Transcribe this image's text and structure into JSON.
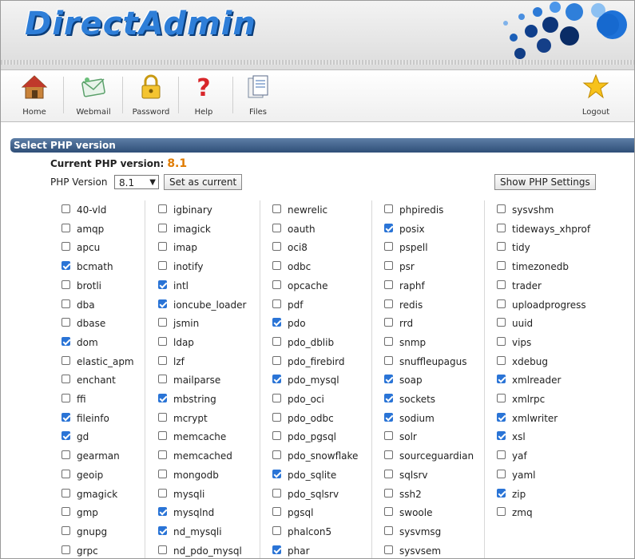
{
  "header": {
    "logo_text": "DirectAdmin"
  },
  "toolbar": {
    "items": [
      {
        "label": "Home",
        "icon": "home-icon"
      },
      {
        "label": "Webmail",
        "icon": "mail-icon"
      },
      {
        "label": "Password",
        "icon": "lock-icon"
      },
      {
        "label": "Help",
        "icon": "question-icon"
      },
      {
        "label": "Files",
        "icon": "files-icon"
      },
      {
        "label": "Logout",
        "icon": "star-icon"
      }
    ]
  },
  "section": {
    "title": "Select PHP version"
  },
  "current": {
    "label": "Current PHP version:",
    "value": "8.1"
  },
  "version_row": {
    "label": "PHP Version",
    "selected": "8.1",
    "set_button": "Set as current",
    "show_button": "Show PHP Settings"
  },
  "colors": {
    "accent": "#2a74d6",
    "section_bar": "#3d5f88",
    "version_value": "#e07b00"
  },
  "extensions": [
    [
      {
        "name": "40-vld",
        "checked": false
      },
      {
        "name": "amqp",
        "checked": false
      },
      {
        "name": "apcu",
        "checked": false
      },
      {
        "name": "bcmath",
        "checked": true
      },
      {
        "name": "brotli",
        "checked": false
      },
      {
        "name": "dba",
        "checked": false
      },
      {
        "name": "dbase",
        "checked": false
      },
      {
        "name": "dom",
        "checked": true
      },
      {
        "name": "elastic_apm",
        "checked": false
      },
      {
        "name": "enchant",
        "checked": false
      },
      {
        "name": "ffi",
        "checked": false
      },
      {
        "name": "fileinfo",
        "checked": true
      },
      {
        "name": "gd",
        "checked": true
      },
      {
        "name": "gearman",
        "checked": false
      },
      {
        "name": "geoip",
        "checked": false
      },
      {
        "name": "gmagick",
        "checked": false
      },
      {
        "name": "gmp",
        "checked": false
      },
      {
        "name": "gnupg",
        "checked": false
      },
      {
        "name": "grpc",
        "checked": false
      }
    ],
    [
      {
        "name": "igbinary",
        "checked": false
      },
      {
        "name": "imagick",
        "checked": false
      },
      {
        "name": "imap",
        "checked": false
      },
      {
        "name": "inotify",
        "checked": false
      },
      {
        "name": "intl",
        "checked": true
      },
      {
        "name": "ioncube_loader",
        "checked": true
      },
      {
        "name": "jsmin",
        "checked": false
      },
      {
        "name": "ldap",
        "checked": false
      },
      {
        "name": "lzf",
        "checked": false
      },
      {
        "name": "mailparse",
        "checked": false
      },
      {
        "name": "mbstring",
        "checked": true
      },
      {
        "name": "mcrypt",
        "checked": false
      },
      {
        "name": "memcache",
        "checked": false
      },
      {
        "name": "memcached",
        "checked": false
      },
      {
        "name": "mongodb",
        "checked": false
      },
      {
        "name": "mysqli",
        "checked": false
      },
      {
        "name": "mysqlnd",
        "checked": true
      },
      {
        "name": "nd_mysqli",
        "checked": true
      },
      {
        "name": "nd_pdo_mysql",
        "checked": false
      }
    ],
    [
      {
        "name": "newrelic",
        "checked": false
      },
      {
        "name": "oauth",
        "checked": false
      },
      {
        "name": "oci8",
        "checked": false
      },
      {
        "name": "odbc",
        "checked": false
      },
      {
        "name": "opcache",
        "checked": false
      },
      {
        "name": "pdf",
        "checked": false
      },
      {
        "name": "pdo",
        "checked": true
      },
      {
        "name": "pdo_dblib",
        "checked": false
      },
      {
        "name": "pdo_firebird",
        "checked": false
      },
      {
        "name": "pdo_mysql",
        "checked": true
      },
      {
        "name": "pdo_oci",
        "checked": false
      },
      {
        "name": "pdo_odbc",
        "checked": false
      },
      {
        "name": "pdo_pgsql",
        "checked": false
      },
      {
        "name": "pdo_snowflake",
        "checked": false
      },
      {
        "name": "pdo_sqlite",
        "checked": true
      },
      {
        "name": "pdo_sqlsrv",
        "checked": false
      },
      {
        "name": "pgsql",
        "checked": false
      },
      {
        "name": "phalcon5",
        "checked": false
      },
      {
        "name": "phar",
        "checked": true
      }
    ],
    [
      {
        "name": "phpiredis",
        "checked": false
      },
      {
        "name": "posix",
        "checked": true
      },
      {
        "name": "pspell",
        "checked": false
      },
      {
        "name": "psr",
        "checked": false
      },
      {
        "name": "raphf",
        "checked": false
      },
      {
        "name": "redis",
        "checked": false
      },
      {
        "name": "rrd",
        "checked": false
      },
      {
        "name": "snmp",
        "checked": false
      },
      {
        "name": "snuffleupagus",
        "checked": false
      },
      {
        "name": "soap",
        "checked": true
      },
      {
        "name": "sockets",
        "checked": true
      },
      {
        "name": "sodium",
        "checked": true
      },
      {
        "name": "solr",
        "checked": false
      },
      {
        "name": "sourceguardian",
        "checked": false
      },
      {
        "name": "sqlsrv",
        "checked": false
      },
      {
        "name": "ssh2",
        "checked": false
      },
      {
        "name": "swoole",
        "checked": false
      },
      {
        "name": "sysvmsg",
        "checked": false
      },
      {
        "name": "sysvsem",
        "checked": false
      }
    ],
    [
      {
        "name": "sysvshm",
        "checked": false
      },
      {
        "name": "tideways_xhprof",
        "checked": false
      },
      {
        "name": "tidy",
        "checked": false
      },
      {
        "name": "timezonedb",
        "checked": false
      },
      {
        "name": "trader",
        "checked": false
      },
      {
        "name": "uploadprogress",
        "checked": false
      },
      {
        "name": "uuid",
        "checked": false
      },
      {
        "name": "vips",
        "checked": false
      },
      {
        "name": "xdebug",
        "checked": false
      },
      {
        "name": "xmlreader",
        "checked": true
      },
      {
        "name": "xmlrpc",
        "checked": false
      },
      {
        "name": "xmlwriter",
        "checked": true
      },
      {
        "name": "xsl",
        "checked": true
      },
      {
        "name": "yaf",
        "checked": false
      },
      {
        "name": "yaml",
        "checked": false
      },
      {
        "name": "zip",
        "checked": true
      },
      {
        "name": "zmq",
        "checked": false
      }
    ]
  ]
}
